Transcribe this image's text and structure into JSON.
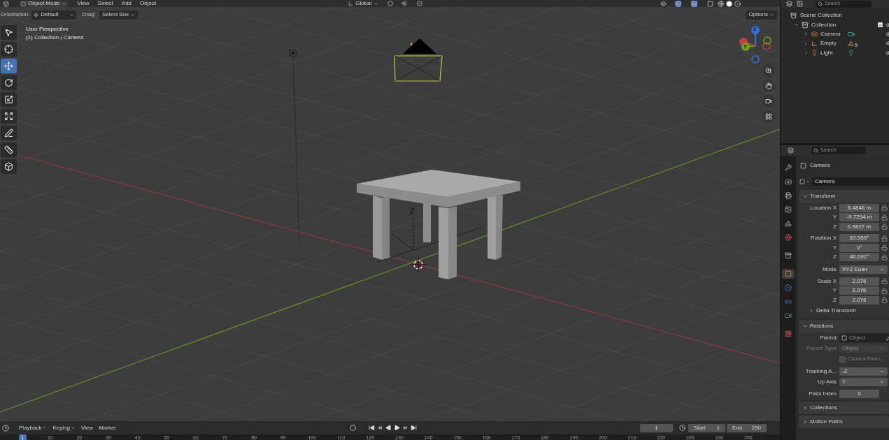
{
  "header": {
    "mode": "Object Mode",
    "menus": [
      "View",
      "Select",
      "Add",
      "Object"
    ],
    "orientation": "Global"
  },
  "tool_settings": {
    "orientation_label": "Orientation:",
    "orientation": "Default",
    "drag_label": "Drag:",
    "drag": "Select Box",
    "options": "Options"
  },
  "viewport": {
    "info": [
      "User Perspective",
      "(1) Collection | Camera"
    ],
    "empty_label": "Z",
    "gizmo_labels": [
      "Z",
      "Y"
    ]
  },
  "toolbar": [
    {
      "kind": "select",
      "selected": false
    },
    {
      "kind": "cursor",
      "selected": false
    },
    {
      "kind": "move",
      "selected": true
    },
    {
      "kind": "rotate",
      "selected": false
    },
    {
      "kind": "scale",
      "selected": false
    },
    {
      "kind": "transform",
      "selected": false
    },
    {
      "kind": "annotate",
      "selected": false
    },
    {
      "kind": "measure",
      "selected": false
    },
    {
      "kind": "add_cube",
      "selected": false
    }
  ],
  "outliner": {
    "search_placeholder": "Search",
    "root": "Scene Collection",
    "collections": [
      {
        "label": "Collection",
        "expanded": true,
        "checked": true,
        "children": [
          {
            "label": "Camera",
            "kind": "camera",
            "expanded": false
          },
          {
            "label": "Empty",
            "kind": "empty",
            "expanded": false,
            "badge": "5"
          },
          {
            "label": "Light",
            "kind": "light",
            "expanded": false
          }
        ]
      }
    ]
  },
  "properties": {
    "search_placeholder": "Search",
    "tabs": [
      {
        "kind": "tool",
        "selected": false
      },
      {
        "kind": "render",
        "selected": false
      },
      {
        "kind": "output",
        "selected": false
      },
      {
        "kind": "view_layer",
        "selected": false
      },
      {
        "kind": "scene",
        "selected": false
      },
      {
        "kind": "world",
        "selected": false
      },
      {
        "kind": "collection",
        "selected": false
      },
      {
        "kind": "object",
        "selected": true
      },
      {
        "kind": "physics",
        "selected": false
      },
      {
        "kind": "constraints",
        "selected": false
      },
      {
        "kind": "data",
        "selected": false
      },
      {
        "kind": "texture",
        "selected": false
      }
    ],
    "object_name": "Camera",
    "datablock": "Camera",
    "panels": [
      {
        "title": "Transform",
        "expanded": true,
        "groups": [
          [
            {
              "kind": "vector",
              "label": "Location X",
              "value": "8.4848 m"
            },
            {
              "kind": "vector",
              "label": "Y",
              "value": "-9.7294 m"
            },
            {
              "kind": "vector",
              "label": "Z",
              "value": "6.9827 m"
            }
          ],
          [
            {
              "kind": "vector",
              "label": "Rotation X",
              "value": "63.559°"
            },
            {
              "kind": "vector",
              "label": "Y",
              "value": "0°"
            },
            {
              "kind": "vector",
              "label": "Z",
              "value": "46.692°"
            }
          ],
          [
            {
              "kind": "dropdown",
              "label": "Mode",
              "value": "XYZ Euler"
            }
          ],
          [
            {
              "kind": "vector",
              "label": "Scale X",
              "value": "2.076"
            },
            {
              "kind": "vector",
              "label": "Y",
              "value": "2.076"
            },
            {
              "kind": "vector",
              "label": "Z",
              "value": "2.076"
            }
          ]
        ],
        "subpanels": [
          {
            "title": "Delta Transform",
            "expanded": false
          }
        ]
      },
      {
        "title": "Relations",
        "expanded": true,
        "groups": [
          [
            {
              "kind": "object",
              "label": "Parent",
              "placeholder": "Object",
              "disabled": false
            },
            {
              "kind": "dropdown",
              "label": "Parent Type",
              "value": "Object",
              "disabled": true
            },
            {
              "kind": "checkbox",
              "label": "Camera Paren...",
              "checked": false,
              "disabled": true
            }
          ],
          [
            {
              "kind": "dropdown",
              "label": "Tracking A...",
              "value": "-Z",
              "disabled": false
            },
            {
              "kind": "dropdown",
              "label": "Up Axis",
              "value": "Y",
              "disabled": false
            }
          ],
          [
            {
              "kind": "number",
              "label": "Pass Index",
              "value": "0",
              "disabled": false
            }
          ]
        ]
      },
      {
        "title": "Collections",
        "expanded": false
      },
      {
        "title": "Motion Paths",
        "expanded": false
      }
    ]
  },
  "timeline": {
    "menus": [
      "Playback",
      "Keying",
      "View",
      "Marker"
    ],
    "current_frame": "1",
    "start_label": "Start",
    "start": "1",
    "end_label": "End",
    "end": "250",
    "ruler_current": "1",
    "ruler_labels": [
      "10",
      "20",
      "30",
      "40",
      "50",
      "60",
      "70",
      "80",
      "90",
      "100",
      "110",
      "120",
      "130",
      "140",
      "150",
      "160",
      "170",
      "180",
      "190",
      "200",
      "210",
      "220",
      "230",
      "240",
      "250"
    ]
  }
}
